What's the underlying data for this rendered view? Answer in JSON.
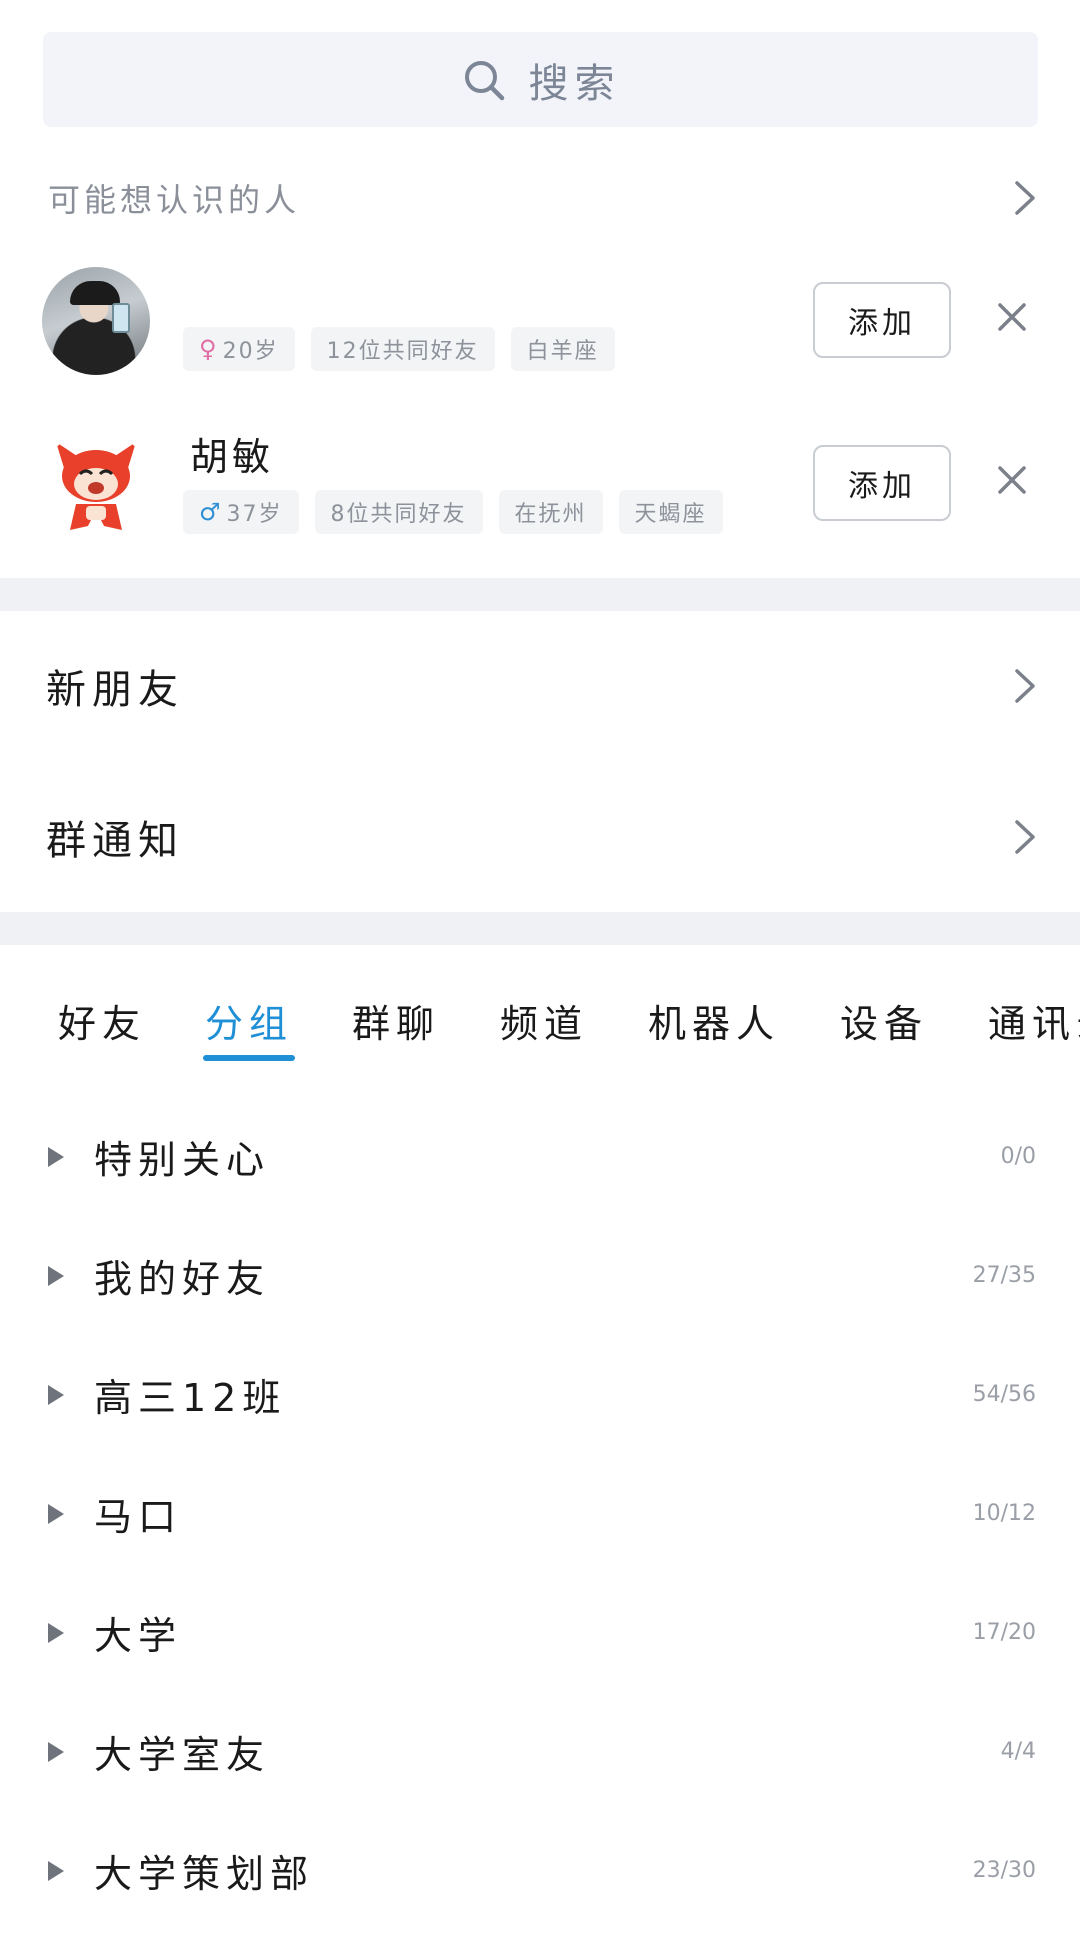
{
  "search": {
    "placeholder": "搜索"
  },
  "suggestions": {
    "title": "可能想认识的人",
    "people": [
      {
        "name": "",
        "tags": [
          {
            "gender": "♀",
            "text": "20岁"
          },
          {
            "text": "12位共同好友"
          },
          {
            "text": "白羊座"
          }
        ],
        "add_label": "添加"
      },
      {
        "name": "胡敏",
        "tags": [
          {
            "gender": "♂",
            "text": "37岁"
          },
          {
            "text": "8位共同好友"
          },
          {
            "text": "在抚州"
          },
          {
            "text": "天蝎座"
          }
        ],
        "add_label": "添加"
      }
    ]
  },
  "menu": {
    "new_friends": "新朋友",
    "group_notice": "群通知"
  },
  "tabs": {
    "items": [
      "好友",
      "分组",
      "群聊",
      "频道",
      "机器人",
      "设备",
      "通讯录"
    ],
    "active": "分组"
  },
  "groups": [
    {
      "name": "特别关心",
      "count": "0/0"
    },
    {
      "name": "我的好友",
      "count": "27/35"
    },
    {
      "name": "高三12班",
      "count": "54/56"
    },
    {
      "name": "马口",
      "count": "10/12"
    },
    {
      "name": "大学",
      "count": "17/20"
    },
    {
      "name": "大学室友",
      "count": "4/4"
    },
    {
      "name": "大学策划部",
      "count": "23/30"
    }
  ],
  "colors": {
    "accent": "#1f8fd6",
    "search_bg": "#f2f4f9",
    "section_divider": "#f0f1f5",
    "female": "#e06fa4",
    "male": "#2f8fd4"
  }
}
